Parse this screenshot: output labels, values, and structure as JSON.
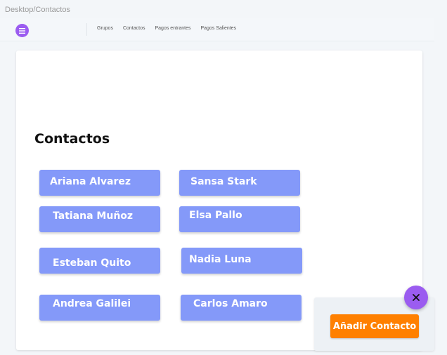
{
  "frame_label": "Desktop/Contactos",
  "icons": {
    "menu": "hamburger-menu-icon",
    "close": "close-x-icon"
  },
  "nav": {
    "items": [
      "Grupos",
      "Contactos",
      "Pagos entrantes",
      "Pagos Salientes"
    ]
  },
  "page": {
    "title": "Contactos"
  },
  "contacts": [
    "Ariana Alvarez",
    "Sansa Stark",
    "Tatiana Muñoz",
    "Elsa Pallo",
    "Esteban Quito",
    "Nadia Luna",
    "Andrea Galilei",
    "Carlos Amaro"
  ],
  "actions": {
    "add_contact": "Añadir Contacto"
  },
  "colors": {
    "accent_purple": "#9b5cf0",
    "contact_button": "#8499f9",
    "add_button": "#ff8000"
  }
}
